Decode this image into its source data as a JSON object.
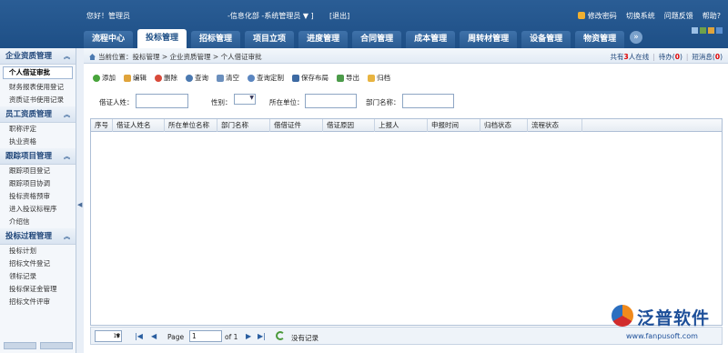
{
  "header": {
    "greeting": "您好！管理员",
    "department": "-信息化部 -系统管理员 ▼ ]",
    "logout": "[退出]",
    "links": [
      "修改密码",
      "切换系统",
      "问题反馈",
      "帮助?"
    ],
    "tabs": [
      "流程中心",
      "投标管理",
      "招标管理",
      "项目立项",
      "进度管理",
      "合同管理",
      "成本管理",
      "周转材管理",
      "设备管理",
      "物资管理"
    ],
    "active_tab": "投标管理",
    "more_icon": "double-chevron-right-icon"
  },
  "sidebar": {
    "sections": [
      {
        "title": "企业资质管理",
        "items": [
          "个人借证审批",
          "财务报表使用登记",
          "资质证书使用记录"
        ]
      },
      {
        "title": "员工资质管理",
        "items": [
          "职称评定",
          "执业资格"
        ]
      },
      {
        "title": "跟踪项目管理",
        "items": [
          "跟踪项目登记",
          "跟踪项目协调",
          "投标资格预审",
          "进入投议标程序",
          "介绍信"
        ]
      },
      {
        "title": "投标过程管理",
        "items": [
          "投标计划",
          "招标文件登记",
          "领标记录",
          "投标保证金管理",
          "招标文件评审"
        ]
      }
    ],
    "active_item": "个人借证审批"
  },
  "breadcrumb": {
    "label": "当前位置：",
    "path": "投标管理 > 企业资质管理 > 个人借证审批"
  },
  "status": {
    "online_prefix": "共有",
    "online_count": "3",
    "online_suffix": "人在线",
    "todo_label": "待办",
    "todo_count": "0",
    "msg_label": "短消息",
    "msg_count": "0"
  },
  "toolbar": [
    "添加",
    "编辑",
    "删除",
    "查询",
    "清空",
    "查询定制",
    "保存布局",
    "导出",
    "归档"
  ],
  "filters": {
    "borrower_label": "借证人姓：",
    "gender_label": "性别：",
    "unit_label": "所在单位：",
    "dept_label": "部门名称："
  },
  "table": {
    "columns": [
      "序号",
      "借证人姓名",
      "所在单位名称",
      "部门名称",
      "借借证件",
      "借证原因",
      "上报人",
      "申报时间",
      "归档状态",
      "流程状态"
    ],
    "rows": []
  },
  "pager": {
    "page_size": "15",
    "page_label": "Page",
    "page_value": "1",
    "of_label": "of 1",
    "empty_text": "没有记录"
  },
  "branding": {
    "name": "泛普软件",
    "url": "www.fanpusoft.com"
  },
  "colors": {
    "header_bg": "#1e4f86",
    "accent_red": "#dd0000"
  }
}
